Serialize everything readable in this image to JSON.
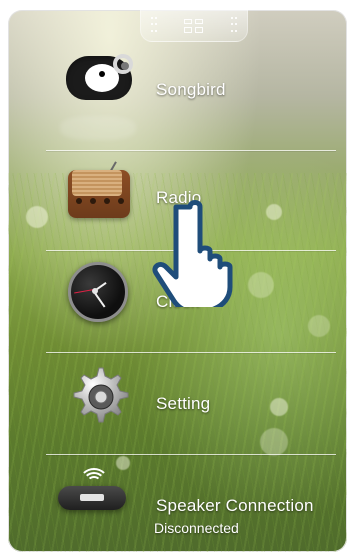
{
  "menu": {
    "items": [
      {
        "label": "Songbird",
        "icon": "songbird-icon"
      },
      {
        "label": "Radio",
        "icon": "radio-icon"
      },
      {
        "label": "Clock",
        "icon": "clock-icon"
      },
      {
        "label": "Setting",
        "icon": "gear-icon"
      },
      {
        "label": "Speaker Connection",
        "status": "Disconnected",
        "icon": "speaker-dock-icon"
      }
    ]
  },
  "top_handle": {
    "icon": "grid-icon"
  },
  "overlay": {
    "pointer": "hand-pointer-icon"
  },
  "colors": {
    "text": "#ffffff",
    "divider": "#ffffff"
  }
}
